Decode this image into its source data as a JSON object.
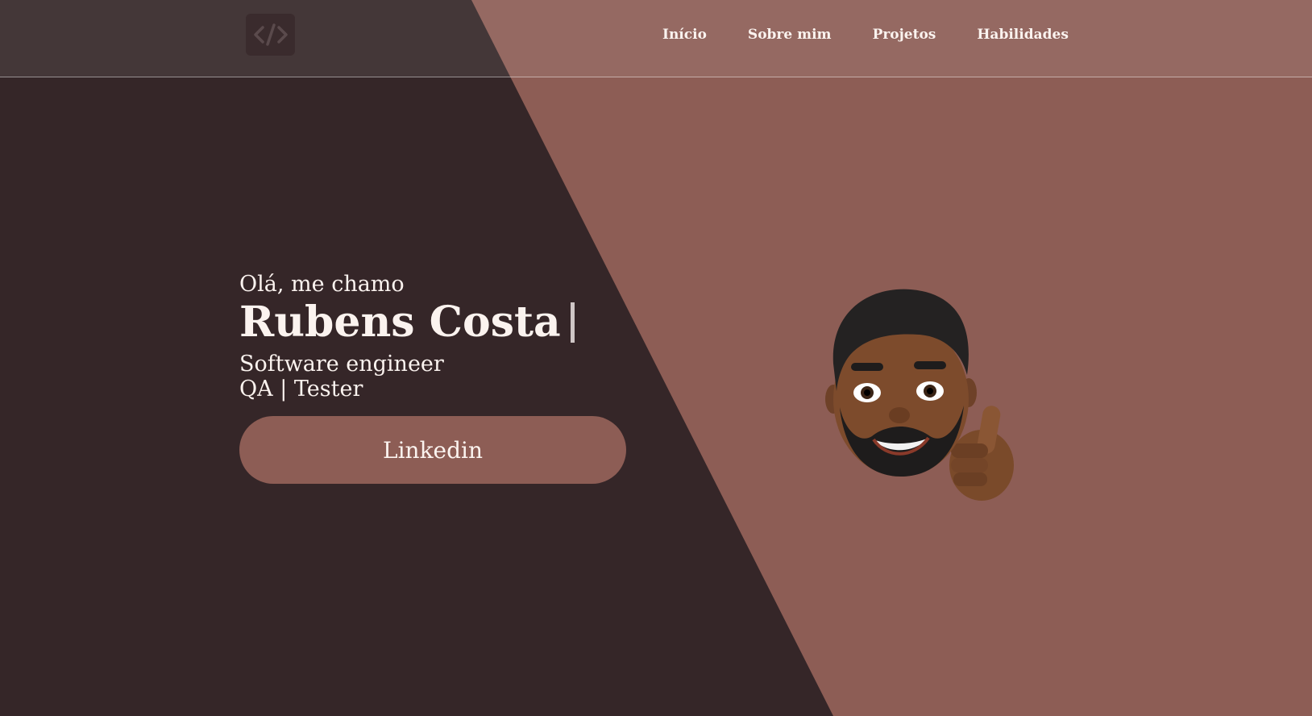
{
  "colors": {
    "dark": "#352628",
    "accent": "#8d5d55",
    "text": "#fbf3ef"
  },
  "header": {
    "logo_icon": "code-icon",
    "nav": [
      {
        "label": "Início"
      },
      {
        "label": "Sobre mim"
      },
      {
        "label": "Projetos"
      },
      {
        "label": "Habilidades"
      }
    ]
  },
  "hero": {
    "greeting": "Olá, me chamo",
    "name": "Rubens Costa",
    "roles": [
      "Software engineer",
      "QA | Tester"
    ],
    "button_label": "Linkedin"
  },
  "avatar": {
    "icon": "memoji-thumbs-up-icon"
  }
}
